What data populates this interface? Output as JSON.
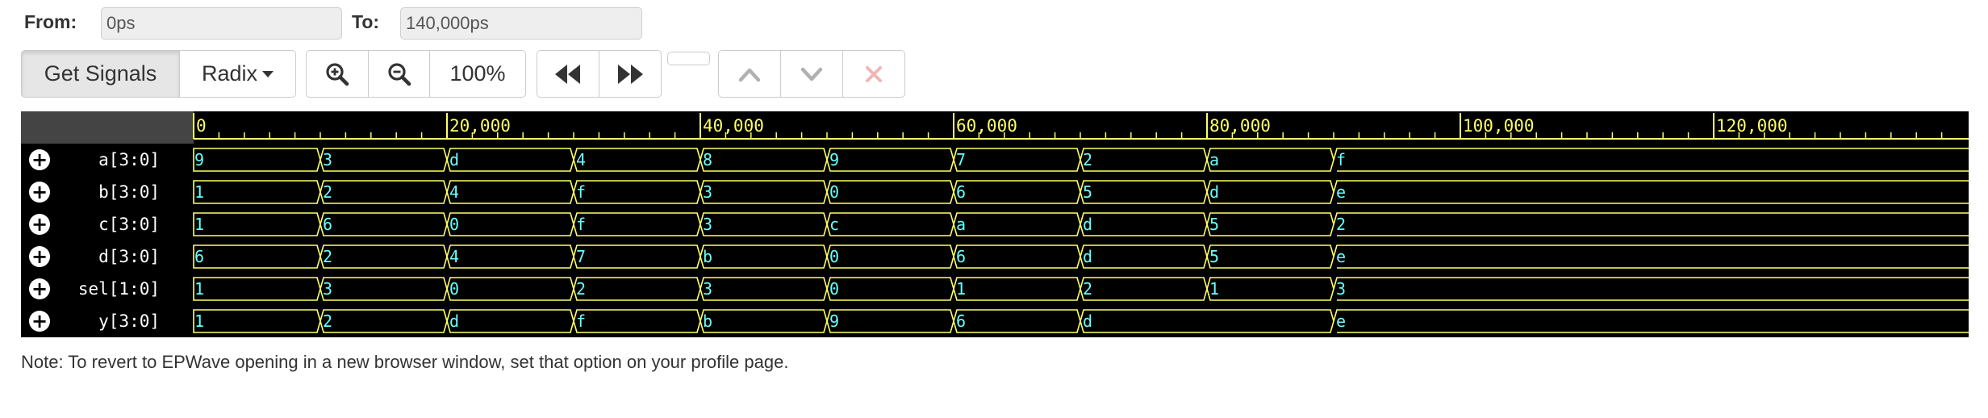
{
  "range": {
    "from_label": "From:",
    "from_value": "0ps",
    "to_label": "To:",
    "to_value": "140,000ps"
  },
  "toolbar": {
    "get_signals": "Get Signals",
    "radix": "Radix",
    "zoom": "100%"
  },
  "icons": {
    "zoom_in": "zoom-in-icon",
    "zoom_out": "zoom-out-icon",
    "rewind": "fast-backward-icon",
    "forward": "fast-forward-icon",
    "up": "chevron-up-icon",
    "down": "chevron-down-icon",
    "close": "close-icon"
  },
  "colors": {
    "wave": "#ffff66",
    "value_text": "#66ffff",
    "close": "#e06060",
    "background": "#000000"
  },
  "timeline": {
    "start": 0,
    "end": 140000,
    "major_ticks": [
      {
        "value": 0,
        "label": "0"
      },
      {
        "value": 20000,
        "label": "20,000"
      },
      {
        "value": 40000,
        "label": "40,000"
      },
      {
        "value": 60000,
        "label": "60,000"
      },
      {
        "value": 80000,
        "label": "80,000"
      },
      {
        "value": 100000,
        "label": "100,000"
      },
      {
        "value": 120000,
        "label": "120,000"
      }
    ],
    "minor_step": 2000
  },
  "signals": [
    {
      "name": "a[3:0]",
      "segments": [
        {
          "t": 0,
          "v": "9"
        },
        {
          "t": 10000,
          "v": "3"
        },
        {
          "t": 20000,
          "v": "d"
        },
        {
          "t": 30000,
          "v": "4"
        },
        {
          "t": 40000,
          "v": "8"
        },
        {
          "t": 50000,
          "v": "9"
        },
        {
          "t": 60000,
          "v": "7"
        },
        {
          "t": 70000,
          "v": "2"
        },
        {
          "t": 80000,
          "v": "a"
        },
        {
          "t": 90000,
          "v": "f"
        }
      ]
    },
    {
      "name": "b[3:0]",
      "segments": [
        {
          "t": 0,
          "v": "1"
        },
        {
          "t": 10000,
          "v": "2"
        },
        {
          "t": 20000,
          "v": "4"
        },
        {
          "t": 30000,
          "v": "f"
        },
        {
          "t": 40000,
          "v": "3"
        },
        {
          "t": 50000,
          "v": "0"
        },
        {
          "t": 60000,
          "v": "6"
        },
        {
          "t": 70000,
          "v": "5"
        },
        {
          "t": 80000,
          "v": "d"
        },
        {
          "t": 90000,
          "v": "e"
        }
      ]
    },
    {
      "name": "c[3:0]",
      "segments": [
        {
          "t": 0,
          "v": "1"
        },
        {
          "t": 10000,
          "v": "6"
        },
        {
          "t": 20000,
          "v": "0"
        },
        {
          "t": 30000,
          "v": "f"
        },
        {
          "t": 40000,
          "v": "3"
        },
        {
          "t": 50000,
          "v": "c"
        },
        {
          "t": 60000,
          "v": "a"
        },
        {
          "t": 70000,
          "v": "d"
        },
        {
          "t": 80000,
          "v": "5"
        },
        {
          "t": 90000,
          "v": "2"
        }
      ]
    },
    {
      "name": "d[3:0]",
      "segments": [
        {
          "t": 0,
          "v": "6"
        },
        {
          "t": 10000,
          "v": "2"
        },
        {
          "t": 20000,
          "v": "4"
        },
        {
          "t": 30000,
          "v": "7"
        },
        {
          "t": 40000,
          "v": "b"
        },
        {
          "t": 50000,
          "v": "0"
        },
        {
          "t": 60000,
          "v": "6"
        },
        {
          "t": 70000,
          "v": "d"
        },
        {
          "t": 80000,
          "v": "5"
        },
        {
          "t": 90000,
          "v": "e"
        }
      ]
    },
    {
      "name": "sel[1:0]",
      "segments": [
        {
          "t": 0,
          "v": "1"
        },
        {
          "t": 10000,
          "v": "3"
        },
        {
          "t": 20000,
          "v": "0"
        },
        {
          "t": 30000,
          "v": "2"
        },
        {
          "t": 40000,
          "v": "3"
        },
        {
          "t": 50000,
          "v": "0"
        },
        {
          "t": 60000,
          "v": "1"
        },
        {
          "t": 70000,
          "v": "2"
        },
        {
          "t": 80000,
          "v": "1"
        },
        {
          "t": 90000,
          "v": "3"
        }
      ]
    },
    {
      "name": "y[3:0]",
      "segments": [
        {
          "t": 0,
          "v": "1"
        },
        {
          "t": 10000,
          "v": "2"
        },
        {
          "t": 20000,
          "v": "d"
        },
        {
          "t": 30000,
          "v": "f"
        },
        {
          "t": 40000,
          "v": "b"
        },
        {
          "t": 50000,
          "v": "9"
        },
        {
          "t": 60000,
          "v": "6"
        },
        {
          "t": 70000,
          "v": "d"
        },
        {
          "t": 90000,
          "v": "e"
        }
      ]
    }
  ],
  "note": "Note: To revert to EPWave opening in a new browser window, set that option on your profile page."
}
